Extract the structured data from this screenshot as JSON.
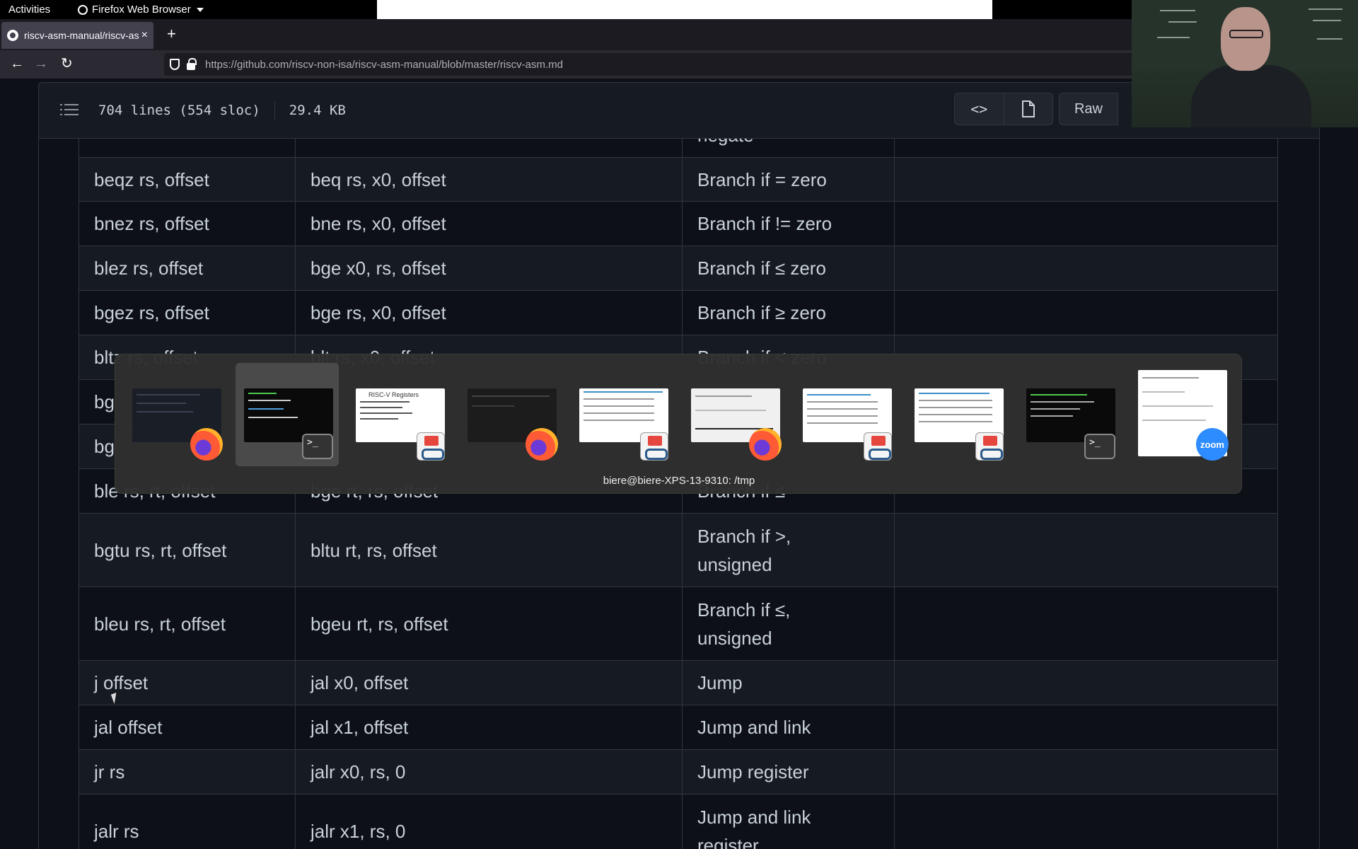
{
  "topbar": {
    "activities": "Activities",
    "app_menu": "Firefox Web Browser"
  },
  "browser": {
    "tab_title": "riscv-asm-manual/riscv-asm",
    "tab_close": "×",
    "new_tab": "+",
    "url_host": "https://github.com",
    "url_path": "/riscv-non-isa/riscv-asm-manual/blob/master/riscv-asm.md",
    "back": "←",
    "forward": "→",
    "reload": "↻"
  },
  "file_header": {
    "lines": "704 lines (554 sloc)",
    "size": "29.4 KB",
    "code_button": "<>",
    "raw_button": "Raw"
  },
  "table": {
    "partial_top_description": "negate",
    "rows": [
      {
        "pseudo": "beqz rs, offset",
        "base": "beq rs, x0, offset",
        "meaning": "Branch if = zero"
      },
      {
        "pseudo": "bnez rs, offset",
        "base": "bne rs, x0, offset",
        "meaning": "Branch if != zero"
      },
      {
        "pseudo": "blez rs, offset",
        "base": "bge x0, rs, offset",
        "meaning": "Branch if ≤ zero"
      },
      {
        "pseudo": "bgez rs, offset",
        "base": "bge rs, x0, offset",
        "meaning": "Branch if ≥ zero"
      },
      {
        "pseudo": "bltz rs, offset",
        "base": "blt rs, x0, offset",
        "meaning": "Branch if < zero"
      },
      {
        "pseudo": "bg",
        "base": "",
        "meaning": ""
      },
      {
        "pseudo": "bg",
        "base": "",
        "meaning": ""
      },
      {
        "pseudo": "ble rs, rt, offset",
        "base": "bge rt, rs, offset",
        "meaning": "Branch if ≤"
      },
      {
        "pseudo": "bgtu rs, rt, offset",
        "base": "bltu rt, rs, offset",
        "meaning_l1": "Branch if >,",
        "meaning_l2": "unsigned"
      },
      {
        "pseudo": "bleu rs, rt, offset",
        "base": "bgeu rt, rs, offset",
        "meaning_l1": "Branch if ≤,",
        "meaning_l2": "unsigned"
      },
      {
        "pseudo": "j offset",
        "base": "jal x0, offset",
        "meaning": "Jump"
      },
      {
        "pseudo": "jal offset",
        "base": "jal x1, offset",
        "meaning": "Jump and link"
      },
      {
        "pseudo": "jr rs",
        "base": "jalr x0, rs, 0",
        "meaning": "Jump register"
      },
      {
        "pseudo": "jalr rs",
        "base": "jalr x1, rs, 0",
        "meaning_l1": "Jump and link",
        "meaning_l2": "register"
      }
    ]
  },
  "switcher": {
    "caption": "biere@biere-XPS-13-9310: /tmp",
    "thumb_title_registers": "RISC-V Registers",
    "terminal_prompt": ">_",
    "zoom_label": "zoom",
    "windows": [
      {
        "app": "firefox-icon",
        "selected": false
      },
      {
        "app": "terminal-icon",
        "selected": true
      },
      {
        "app": "image-viewer-icon",
        "selected": false
      },
      {
        "app": "firefox-icon",
        "selected": false
      },
      {
        "app": "image-viewer-icon",
        "selected": false
      },
      {
        "app": "firefox-icon",
        "selected": false
      },
      {
        "app": "image-viewer-icon",
        "selected": false
      },
      {
        "app": "image-viewer-icon",
        "selected": false
      },
      {
        "app": "terminal-icon",
        "selected": false
      },
      {
        "app": "zoom-icon",
        "selected": false
      }
    ]
  },
  "colors": {
    "page_bg": "#0d1117",
    "table_border": "#30363d",
    "text": "#c9d1d9",
    "switcher_bg": "#303030"
  }
}
